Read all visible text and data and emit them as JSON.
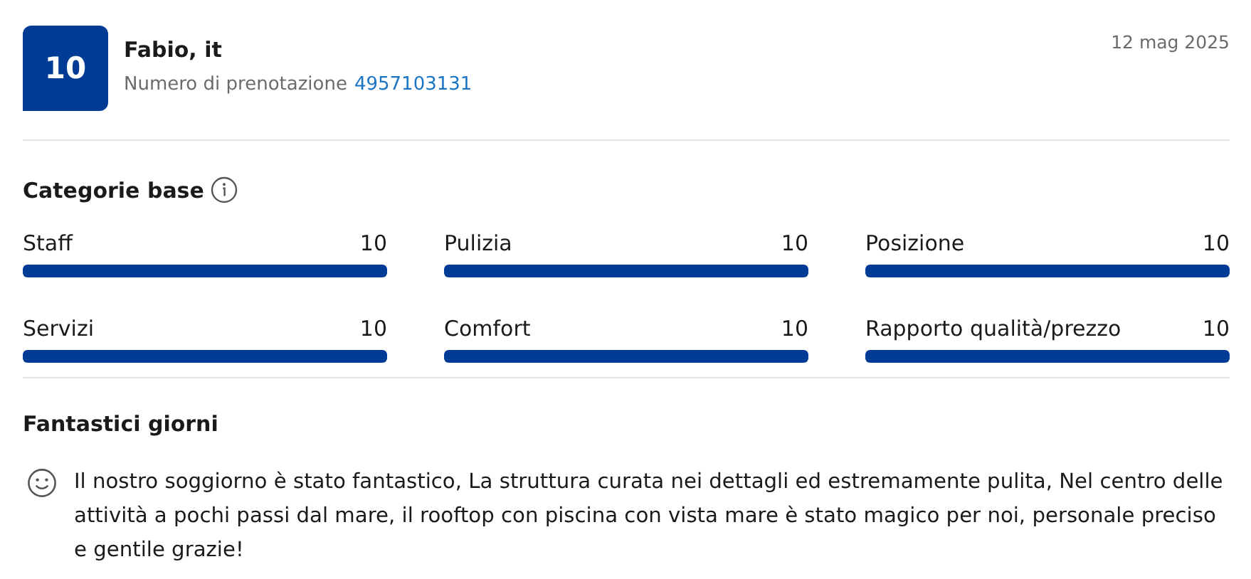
{
  "review": {
    "score": "10",
    "reviewer": "Fabio, it",
    "booking_label": "Numero di prenotazione",
    "booking_number": "4957103131",
    "date": "12 mag 2025"
  },
  "categories": {
    "title": "Categorie base",
    "items": [
      {
        "name": "Staff",
        "score": "10",
        "level": 1
      },
      {
        "name": "Pulizia",
        "score": "10",
        "level": 1
      },
      {
        "name": "Posizione",
        "score": "10",
        "level": 1
      },
      {
        "name": "Servizi",
        "score": "10",
        "level": 1
      },
      {
        "name": "Comfort",
        "score": "10",
        "level": 1
      },
      {
        "name": "Rapporto qualità/prezzo",
        "score": "10",
        "level": 1
      }
    ]
  },
  "comment": {
    "title": "Fantastici giorni",
    "text": "Il nostro soggiorno è stato fantastico, La struttura curata nei dettagli ed estremamente pulita, Nel centro delle attività a pochi passi dal mare, il rooftop con piscina con vista mare è stato magico per noi, personale preciso e gentile grazie!"
  }
}
